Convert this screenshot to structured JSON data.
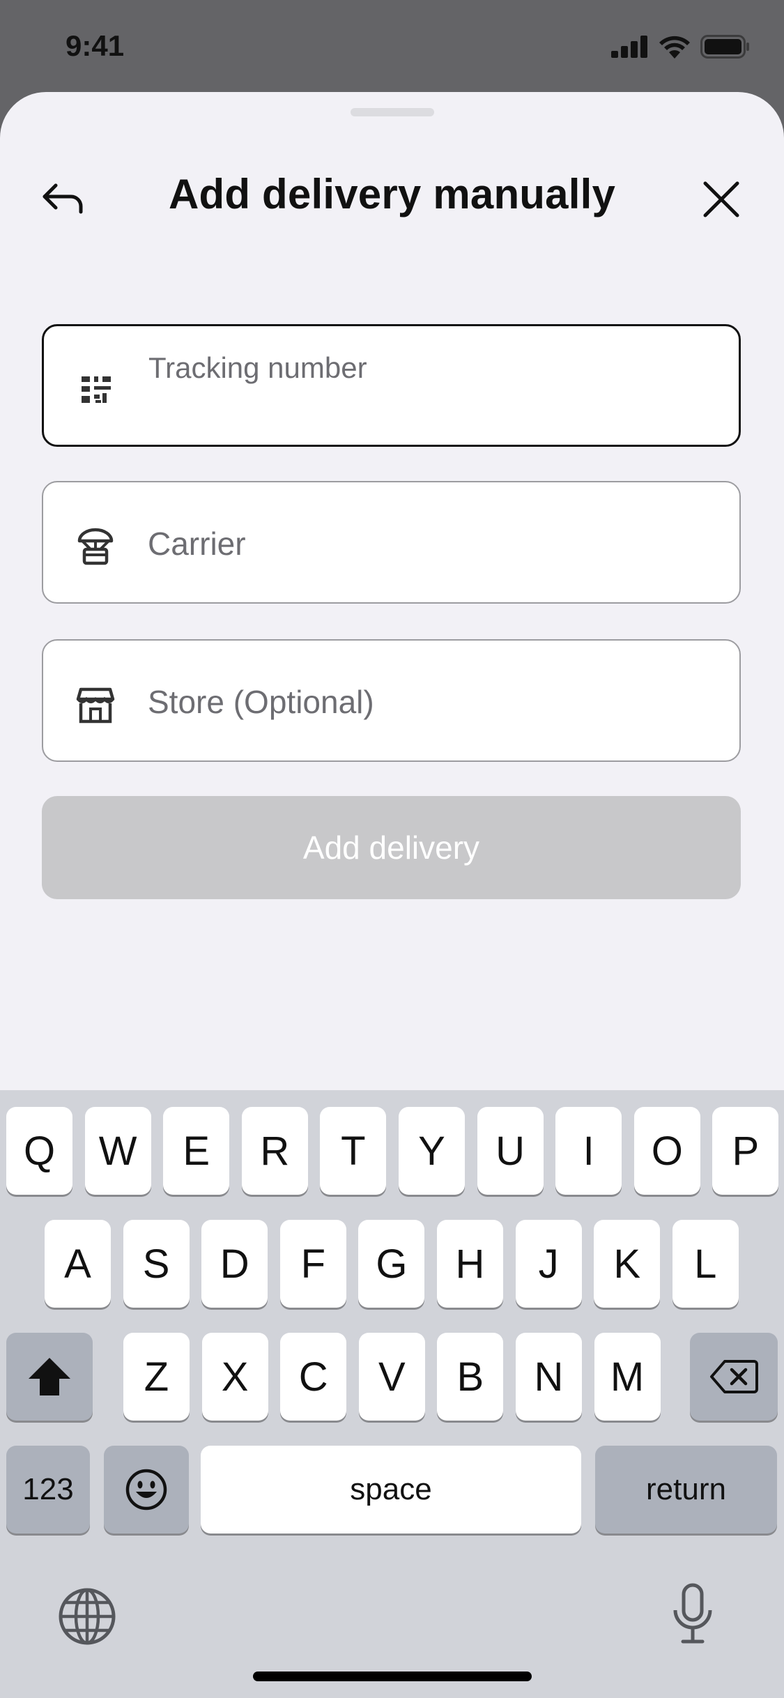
{
  "status_bar": {
    "time": "9:41",
    "icons": [
      "cellular-signal-icon",
      "wifi-icon",
      "battery-icon"
    ]
  },
  "header": {
    "title": "Add delivery manually",
    "back_icon": "back-arrow-icon",
    "close_icon": "close-icon"
  },
  "form": {
    "tracking": {
      "placeholder": "Tracking number",
      "value": "",
      "icon": "barcode-icon",
      "focused": true
    },
    "carrier": {
      "placeholder": "Carrier",
      "value": "",
      "icon": "parachute-box-icon"
    },
    "store": {
      "placeholder": "Store (Optional)",
      "value": "",
      "icon": "storefront-icon"
    },
    "submit_label": "Add delivery",
    "submit_enabled": false
  },
  "keyboard": {
    "row1": [
      "Q",
      "W",
      "E",
      "R",
      "T",
      "Y",
      "U",
      "I",
      "O",
      "P"
    ],
    "row2": [
      "A",
      "S",
      "D",
      "F",
      "G",
      "H",
      "J",
      "K",
      "L"
    ],
    "row3": [
      "Z",
      "X",
      "C",
      "V",
      "B",
      "N",
      "M"
    ],
    "shift_icon": "shift-icon",
    "delete_icon": "delete-icon",
    "numbers_label": "123",
    "emoji_icon": "emoji-icon",
    "space_label": "space",
    "return_label": "return",
    "globe_icon": "globe-icon",
    "mic_icon": "microphone-icon"
  },
  "colors": {
    "background_dim": "#646467",
    "sheet": "#f2f1f6",
    "keyboard": "#d1d3d9",
    "disabled_button": "#c8c8ca"
  }
}
